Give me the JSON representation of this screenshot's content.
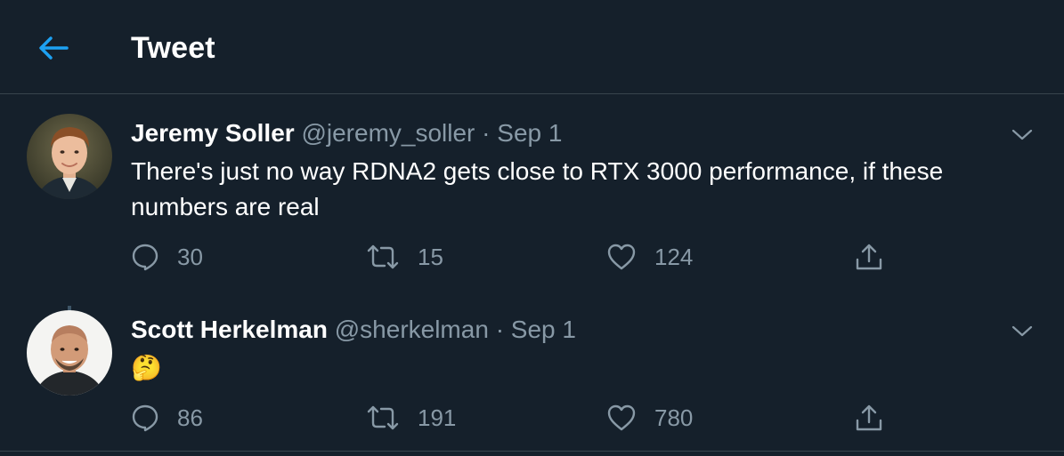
{
  "header": {
    "title": "Tweet",
    "back_icon": "arrow-left-icon",
    "accent_color": "#1da1f2"
  },
  "tweets": [
    {
      "name": "Jeremy Soller",
      "handle": "@jeremy_soller",
      "separator": "·",
      "date": "Sep 1",
      "text": "There's just no way RDNA2 gets close to RTX 3000 performance, if these numbers are real",
      "replies": "30",
      "retweets": "15",
      "likes": "124"
    },
    {
      "name": "Scott Herkelman",
      "handle": "@sherkelman",
      "separator": "·",
      "date": "Sep 1",
      "text": "🤔",
      "replies": "86",
      "retweets": "191",
      "likes": "780"
    }
  ],
  "colors": {
    "background": "#15202b",
    "border": "#38444d",
    "secondary_text": "#8899a6",
    "primary_text": "#ffffff"
  }
}
